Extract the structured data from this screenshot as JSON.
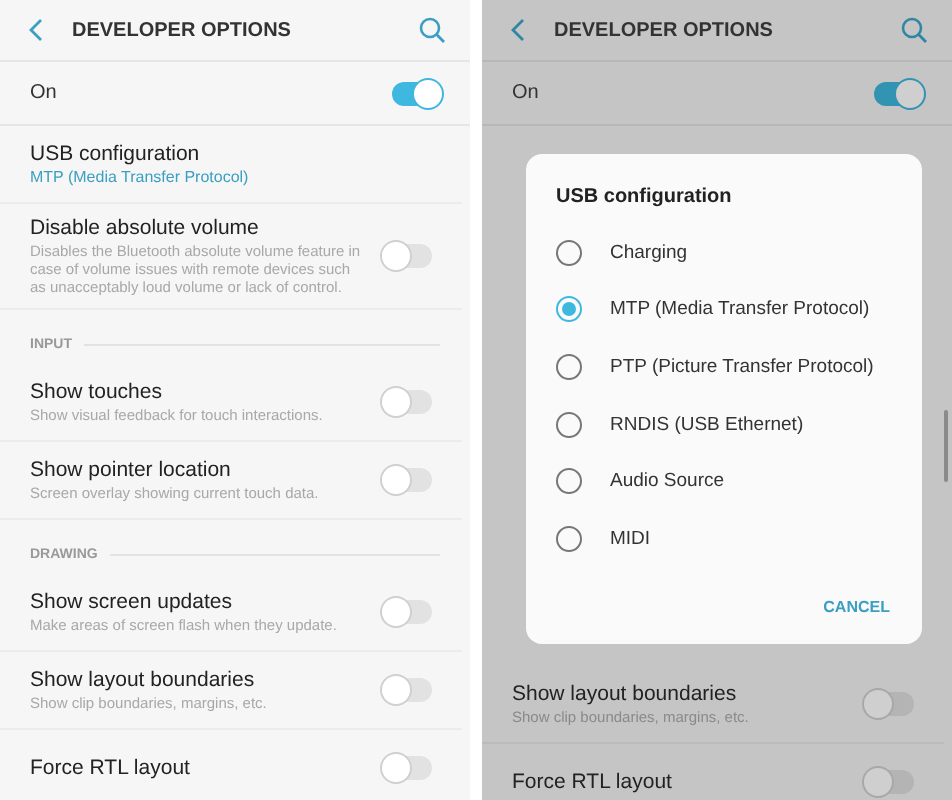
{
  "screens": [
    {
      "header": {
        "title": "DEVELOPER OPTIONS"
      },
      "master": {
        "label": "On",
        "on": true
      },
      "items": [
        {
          "kind": "nav",
          "title": "USB configuration",
          "value": "MTP (Media Transfer Protocol)"
        },
        {
          "kind": "switch",
          "title": "Disable absolute volume",
          "summary": "Disables the Bluetooth absolute volume feature in case of volume issues with remote devices such as unacceptably loud volume or lack of control.",
          "on": false
        },
        {
          "kind": "section",
          "title": "INPUT"
        },
        {
          "kind": "switch",
          "title": "Show touches",
          "summary": "Show visual feedback for touch interactions.",
          "on": false
        },
        {
          "kind": "switch",
          "title": "Show pointer location",
          "summary": "Screen overlay showing current touch data.",
          "on": false
        },
        {
          "kind": "section",
          "title": "DRAWING"
        },
        {
          "kind": "switch",
          "title": "Show screen updates",
          "summary": "Make areas of screen flash when they update.",
          "on": false
        },
        {
          "kind": "switch",
          "title": "Show layout boundaries",
          "summary": "Show clip boundaries, margins, etc.",
          "on": false
        },
        {
          "kind": "switch",
          "title": "Force RTL layout",
          "on": false
        }
      ]
    },
    {
      "header": {
        "title": "DEVELOPER OPTIONS"
      },
      "master": {
        "label": "On",
        "on": true
      },
      "dialog": {
        "title": "USB configuration",
        "options": [
          {
            "label": "Charging",
            "selected": false
          },
          {
            "label": "MTP (Media Transfer Protocol)",
            "selected": true
          },
          {
            "label": "PTP (Picture Transfer Protocol)",
            "selected": false
          },
          {
            "label": "RNDIS (USB Ethernet)",
            "selected": false
          },
          {
            "label": "Audio Source",
            "selected": false
          },
          {
            "label": "MIDI",
            "selected": false
          }
        ],
        "button": "CANCEL"
      },
      "items": [
        {
          "kind": "switch",
          "title": "Show layout boundaries",
          "summary": "Show clip boundaries, margins, etc.",
          "on": false
        },
        {
          "kind": "switch",
          "title": "Force RTL layout",
          "on": false
        }
      ]
    }
  ]
}
